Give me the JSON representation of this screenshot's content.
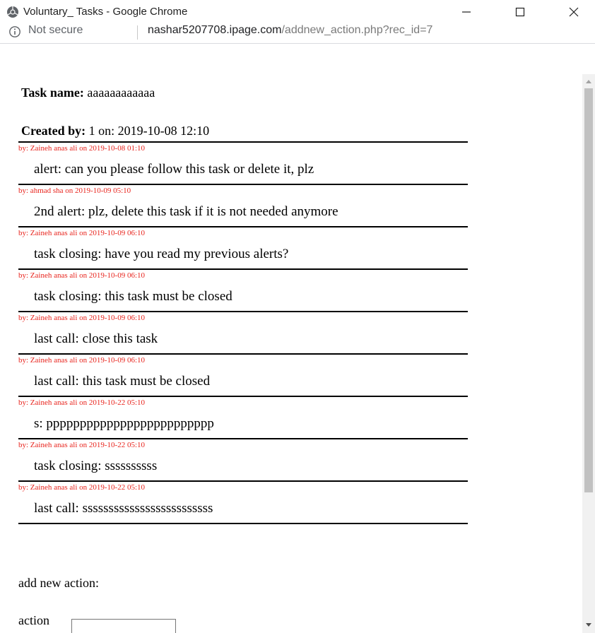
{
  "window": {
    "title": "Voluntary_ Tasks - Google Chrome"
  },
  "address_bar": {
    "security_label": "Not secure",
    "url_host": "nashar5207708.ipage.com",
    "url_path": "/addnew_action.php?rec_id=7"
  },
  "task": {
    "name_label": "Task name:",
    "name_value": "aaaaaaaaaaaa",
    "created_label": "Created by:",
    "created_value": "1 on: 2019-10-08 12:10"
  },
  "actions": [
    {
      "meta": "by: Zaineh anas ali on 2019-10-08 01:10",
      "text": "alert: can you please follow this task or delete it, plz"
    },
    {
      "meta": "by: ahmad sha on 2019-10-09 05:10",
      "text": "2nd alert: plz, delete this task if it is not needed anymore"
    },
    {
      "meta": "by: Zaineh anas ali on 2019-10-09 06:10",
      "text": "task closing: have you read my previous alerts?"
    },
    {
      "meta": "by: Zaineh anas ali on 2019-10-09 06:10",
      "text": "task closing: this task must be closed"
    },
    {
      "meta": "by: Zaineh anas ali on 2019-10-09 06:10",
      "text": "last call: close this task"
    },
    {
      "meta": "by: Zaineh anas ali on 2019-10-09 06:10",
      "text": "last call: this task must be closed"
    },
    {
      "meta": "by: Zaineh anas ali on 2019-10-22 05:10",
      "text": "s: ppppppppppppppppppppppppp"
    },
    {
      "meta": "by: Zaineh anas ali on 2019-10-22 05:10",
      "text": "task closing: ssssssssss"
    },
    {
      "meta": "by: Zaineh anas ali on 2019-10-22 05:10",
      "text": "last call: sssssssssssssssssssssssss"
    }
  ],
  "form": {
    "add_label": "add new action:",
    "action_label": "action",
    "action_value": ""
  },
  "colors": {
    "meta_text": "#e8231c",
    "rule": "#000000"
  },
  "icons": [
    "chrome-icon",
    "minimize-icon",
    "maximize-icon",
    "close-icon",
    "info-icon",
    "scroll-up-icon",
    "scroll-down-icon"
  ]
}
